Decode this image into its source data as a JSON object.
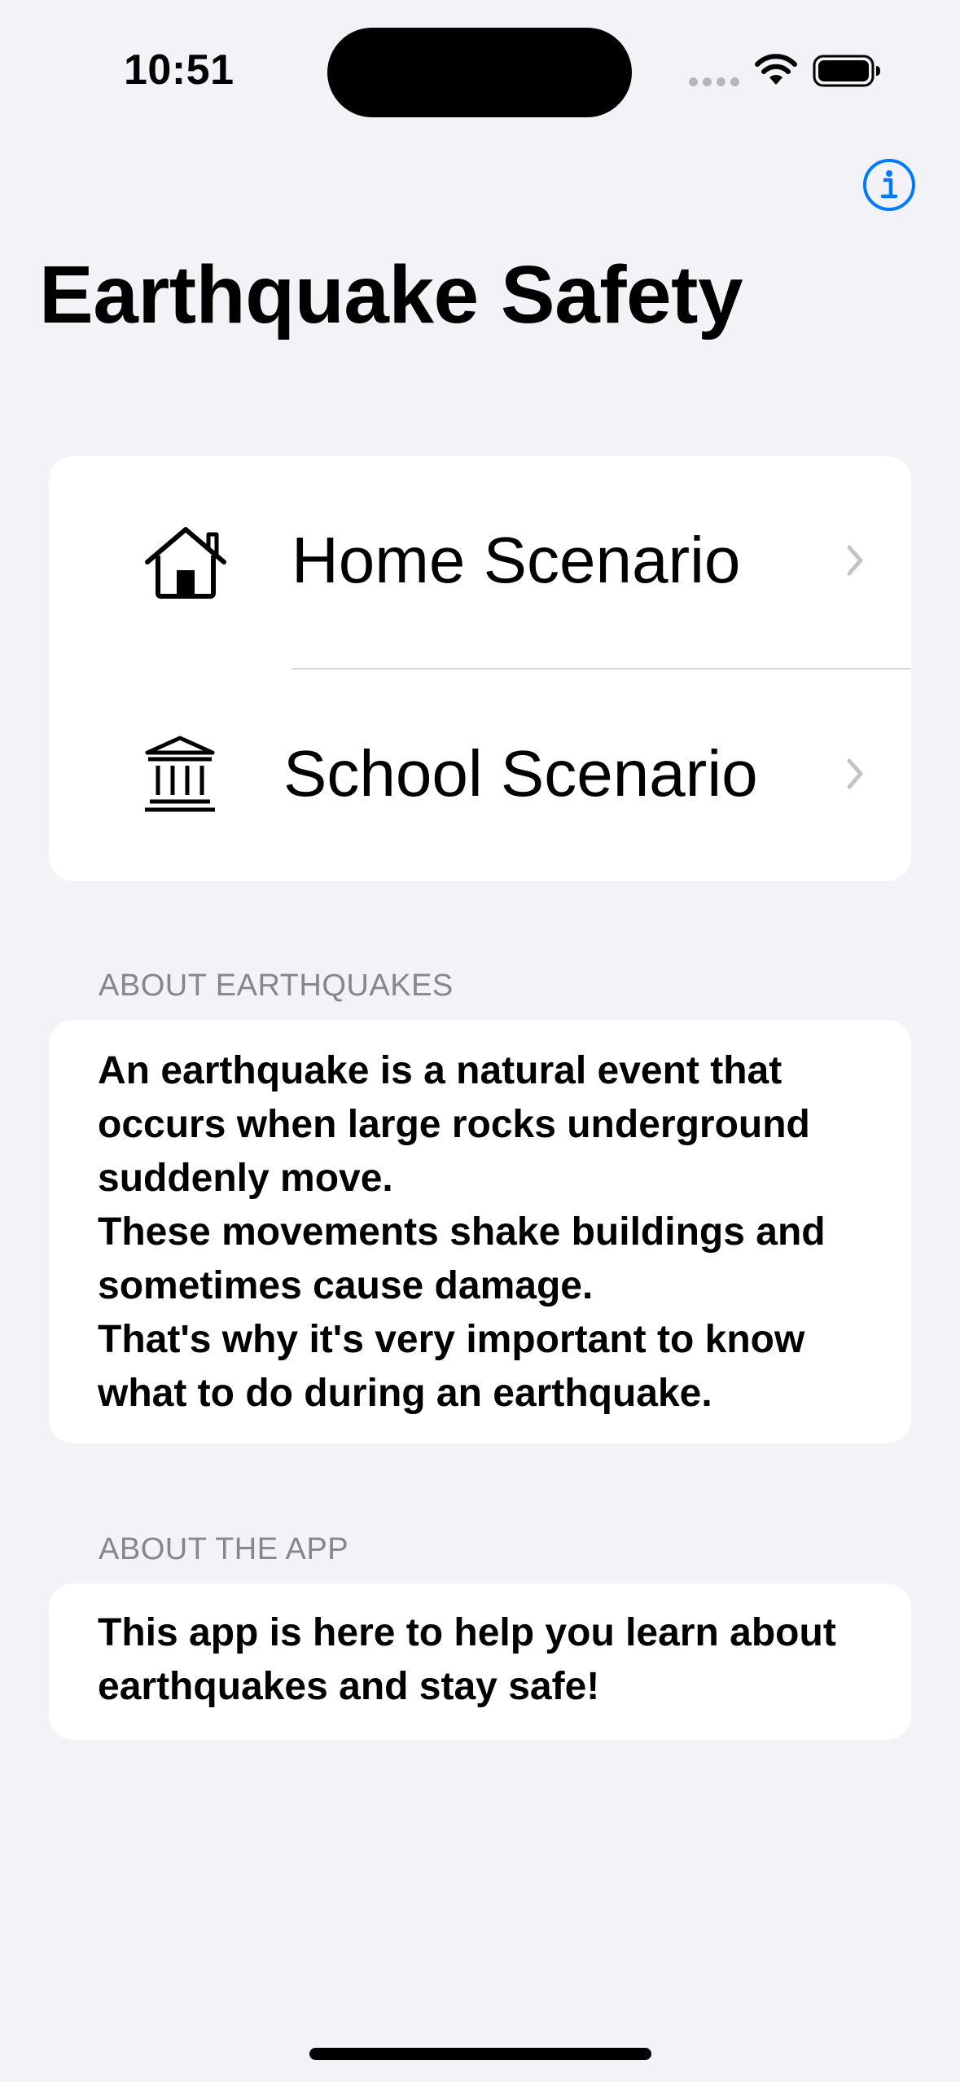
{
  "status_bar": {
    "time": "10:51"
  },
  "nav": {
    "title": "Earthquake Safety"
  },
  "scenarios": [
    {
      "label": "Home Scenario",
      "icon": "house-icon"
    },
    {
      "label": "School Scenario",
      "icon": "building-columns-icon"
    }
  ],
  "about_earthquakes": {
    "header": "ABOUT EARTHQUAKES",
    "body": "An earthquake is a natural event that\noccurs when large rocks underground\nsuddenly move.\nThese movements shake buildings and\nsometimes cause damage.\nThat's why it's very important to know\nwhat to do during an earthquake."
  },
  "about_app": {
    "header": "ABOUT THE APP",
    "body": "This app is here to help you learn about\nearthquakes and stay safe!"
  },
  "colors": {
    "background": "#f2f2f7",
    "accent": "#007aff",
    "secondary_text": "#86868b"
  }
}
